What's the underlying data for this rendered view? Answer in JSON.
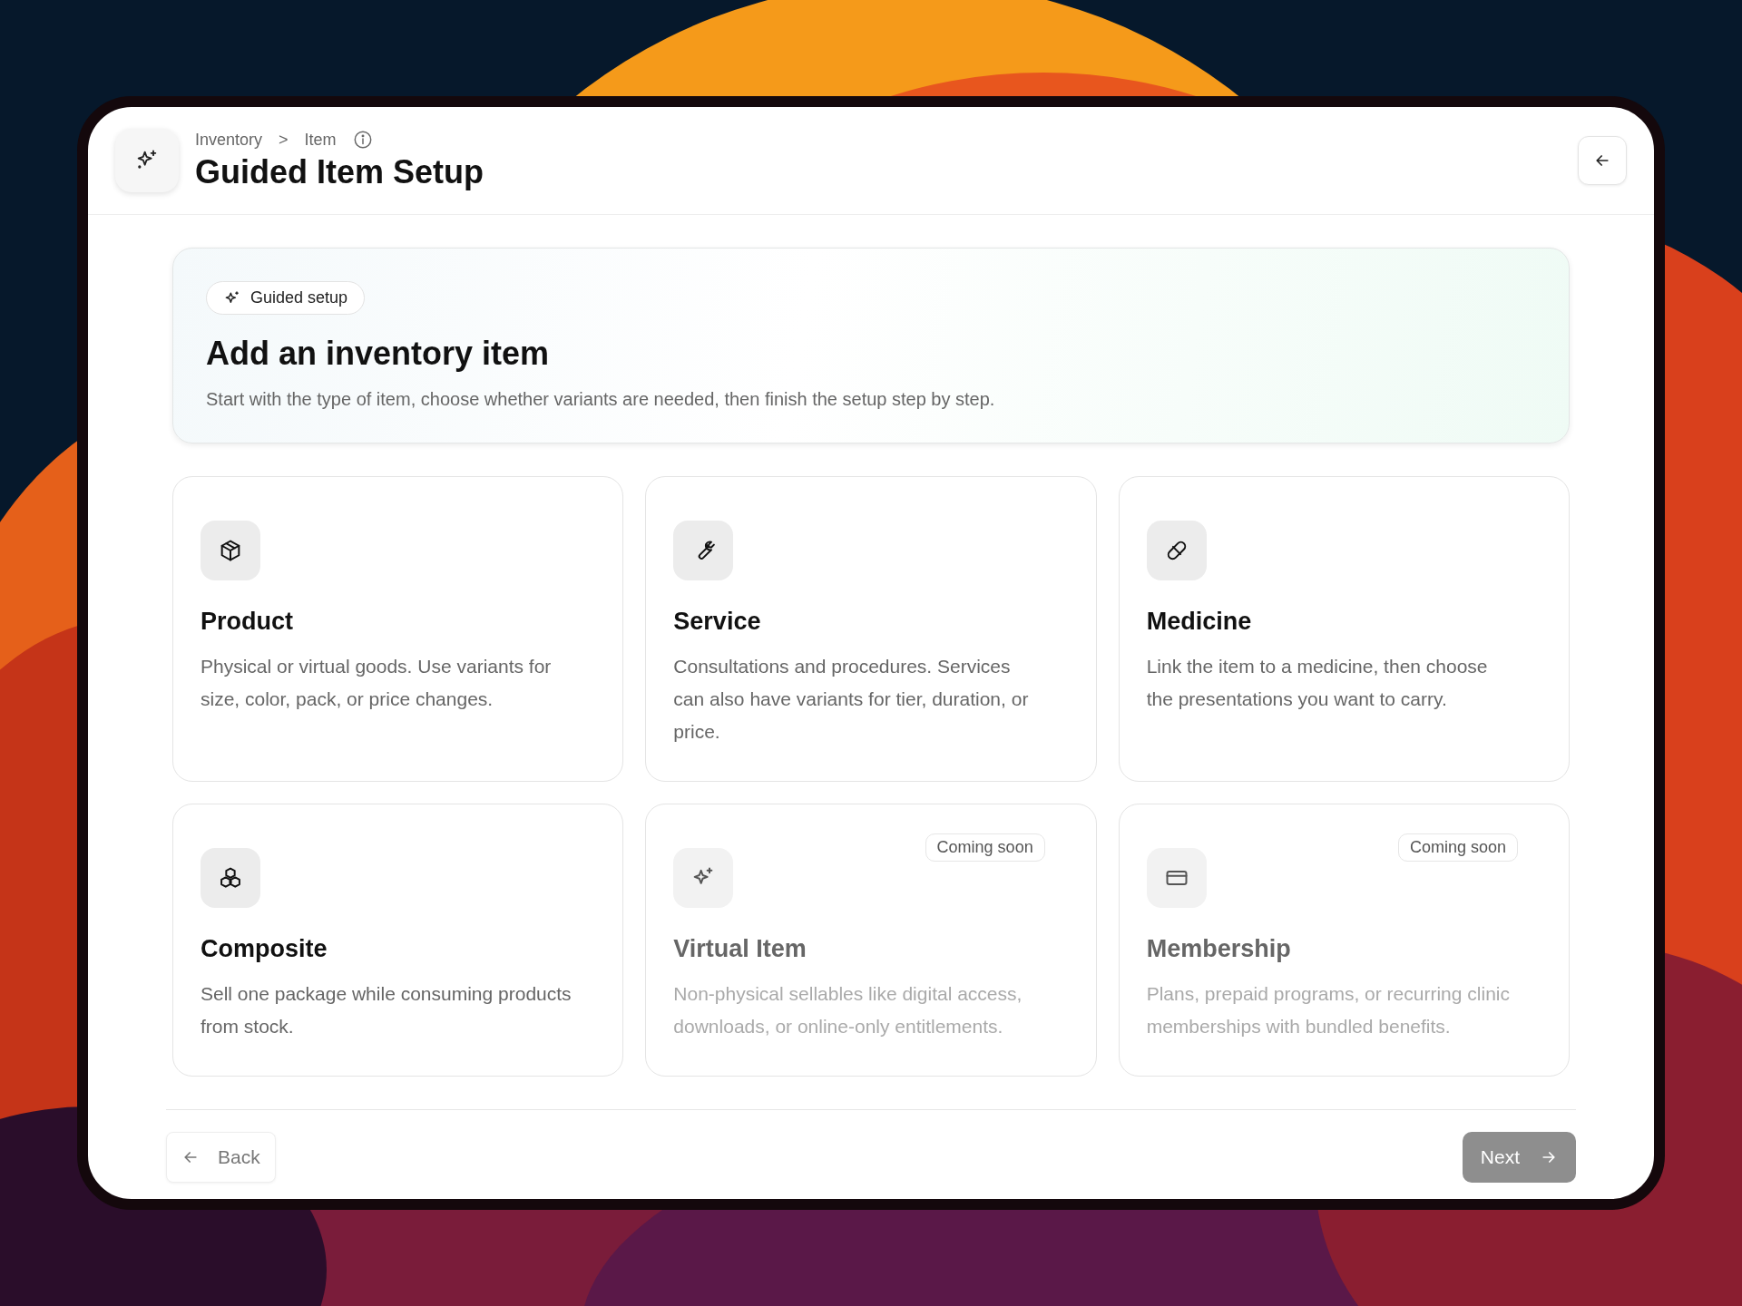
{
  "header": {
    "breadcrumbs": [
      {
        "label": "Inventory"
      },
      {
        "label": "Item"
      }
    ],
    "breadcrumb_separator": ">",
    "title": "Guided Item Setup"
  },
  "hero": {
    "badge": "Guided setup",
    "title": "Add an inventory item",
    "description": "Start with the type of item, choose whether variants are needed, then finish the setup step by step."
  },
  "types": [
    {
      "kind": "box",
      "title": "Product",
      "description": "Physical or virtual goods. Use variants for size, color, pack, or price changes.",
      "disabled": false
    },
    {
      "kind": "wrench",
      "title": "Service",
      "description": "Consultations and procedures. Services can also have variants for tier, duration, or price.",
      "disabled": false
    },
    {
      "kind": "pill",
      "title": "Medicine",
      "description": "Link the item to a medicine, then choose the presentations you want to carry.",
      "disabled": false
    },
    {
      "kind": "boxes",
      "title": "Composite",
      "description": "Sell one package while consuming products from stock.",
      "disabled": false
    },
    {
      "kind": "sparkles",
      "title": "Virtual Item",
      "description": "Non-physical sellables like digital access, downloads, or online-only entitlements.",
      "disabled": true,
      "badge": "Coming soon"
    },
    {
      "kind": "card",
      "title": "Membership",
      "description": "Plans, prepaid programs, or recurring clinic memberships with bundled benefits.",
      "disabled": true,
      "badge": "Coming soon"
    }
  ],
  "footer": {
    "back": {
      "label": "Back"
    },
    "next": {
      "label": "Next",
      "disabled": true
    }
  }
}
